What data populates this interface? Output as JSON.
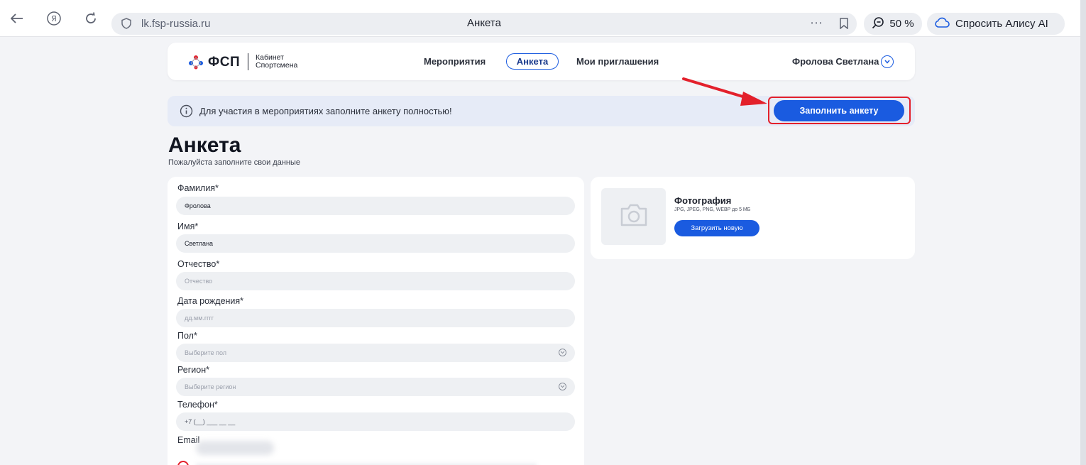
{
  "browser": {
    "url": "lk.fsp-russia.ru",
    "tab_title": "Анкета",
    "more_icon": "⋯",
    "zoom": "50 %",
    "alice_label": "Спросить Алису AI"
  },
  "site_header": {
    "logo_text": "ФСП",
    "logo_sub_line1": "Кабинет",
    "logo_sub_line2": "Спортсмена",
    "nav": [
      {
        "label": "Мероприятия"
      },
      {
        "label": "Анкета",
        "active": true
      },
      {
        "label": "Мои приглашения"
      }
    ],
    "user_name": "Фролова Светлана"
  },
  "banner": {
    "text": "Для участия в мероприятиях заполните анкету полностью!",
    "button_label": "Заполнить анкету"
  },
  "page": {
    "title": "Анкета",
    "subtitle": "Пожалуйста заполните свои данные"
  },
  "form": {
    "fields": [
      {
        "label": "Фамилия*",
        "value": "Фролова"
      },
      {
        "label": "Имя*",
        "value": "Светлана"
      },
      {
        "label": "Отчество*",
        "placeholder": "Отчество"
      },
      {
        "label": "Дата рождения*",
        "placeholder": "дд.мм.гггг"
      },
      {
        "label": "Пол*",
        "placeholder": "Выберите пол"
      },
      {
        "label": "Регион*",
        "placeholder": "Выберите регион"
      },
      {
        "label": "Телефон*",
        "placeholder": "+7 (__) ___ __ __"
      },
      {
        "label": "Email"
      }
    ]
  },
  "photo": {
    "title": "Фотография",
    "hint": "JPG, JPEG, PNG, WEBP до 5 МБ",
    "upload_label": "Загрузить новую"
  },
  "colors": {
    "accent": "#1a5be0",
    "highlight": "#e3202b",
    "banner_bg": "#e6ebf7"
  }
}
